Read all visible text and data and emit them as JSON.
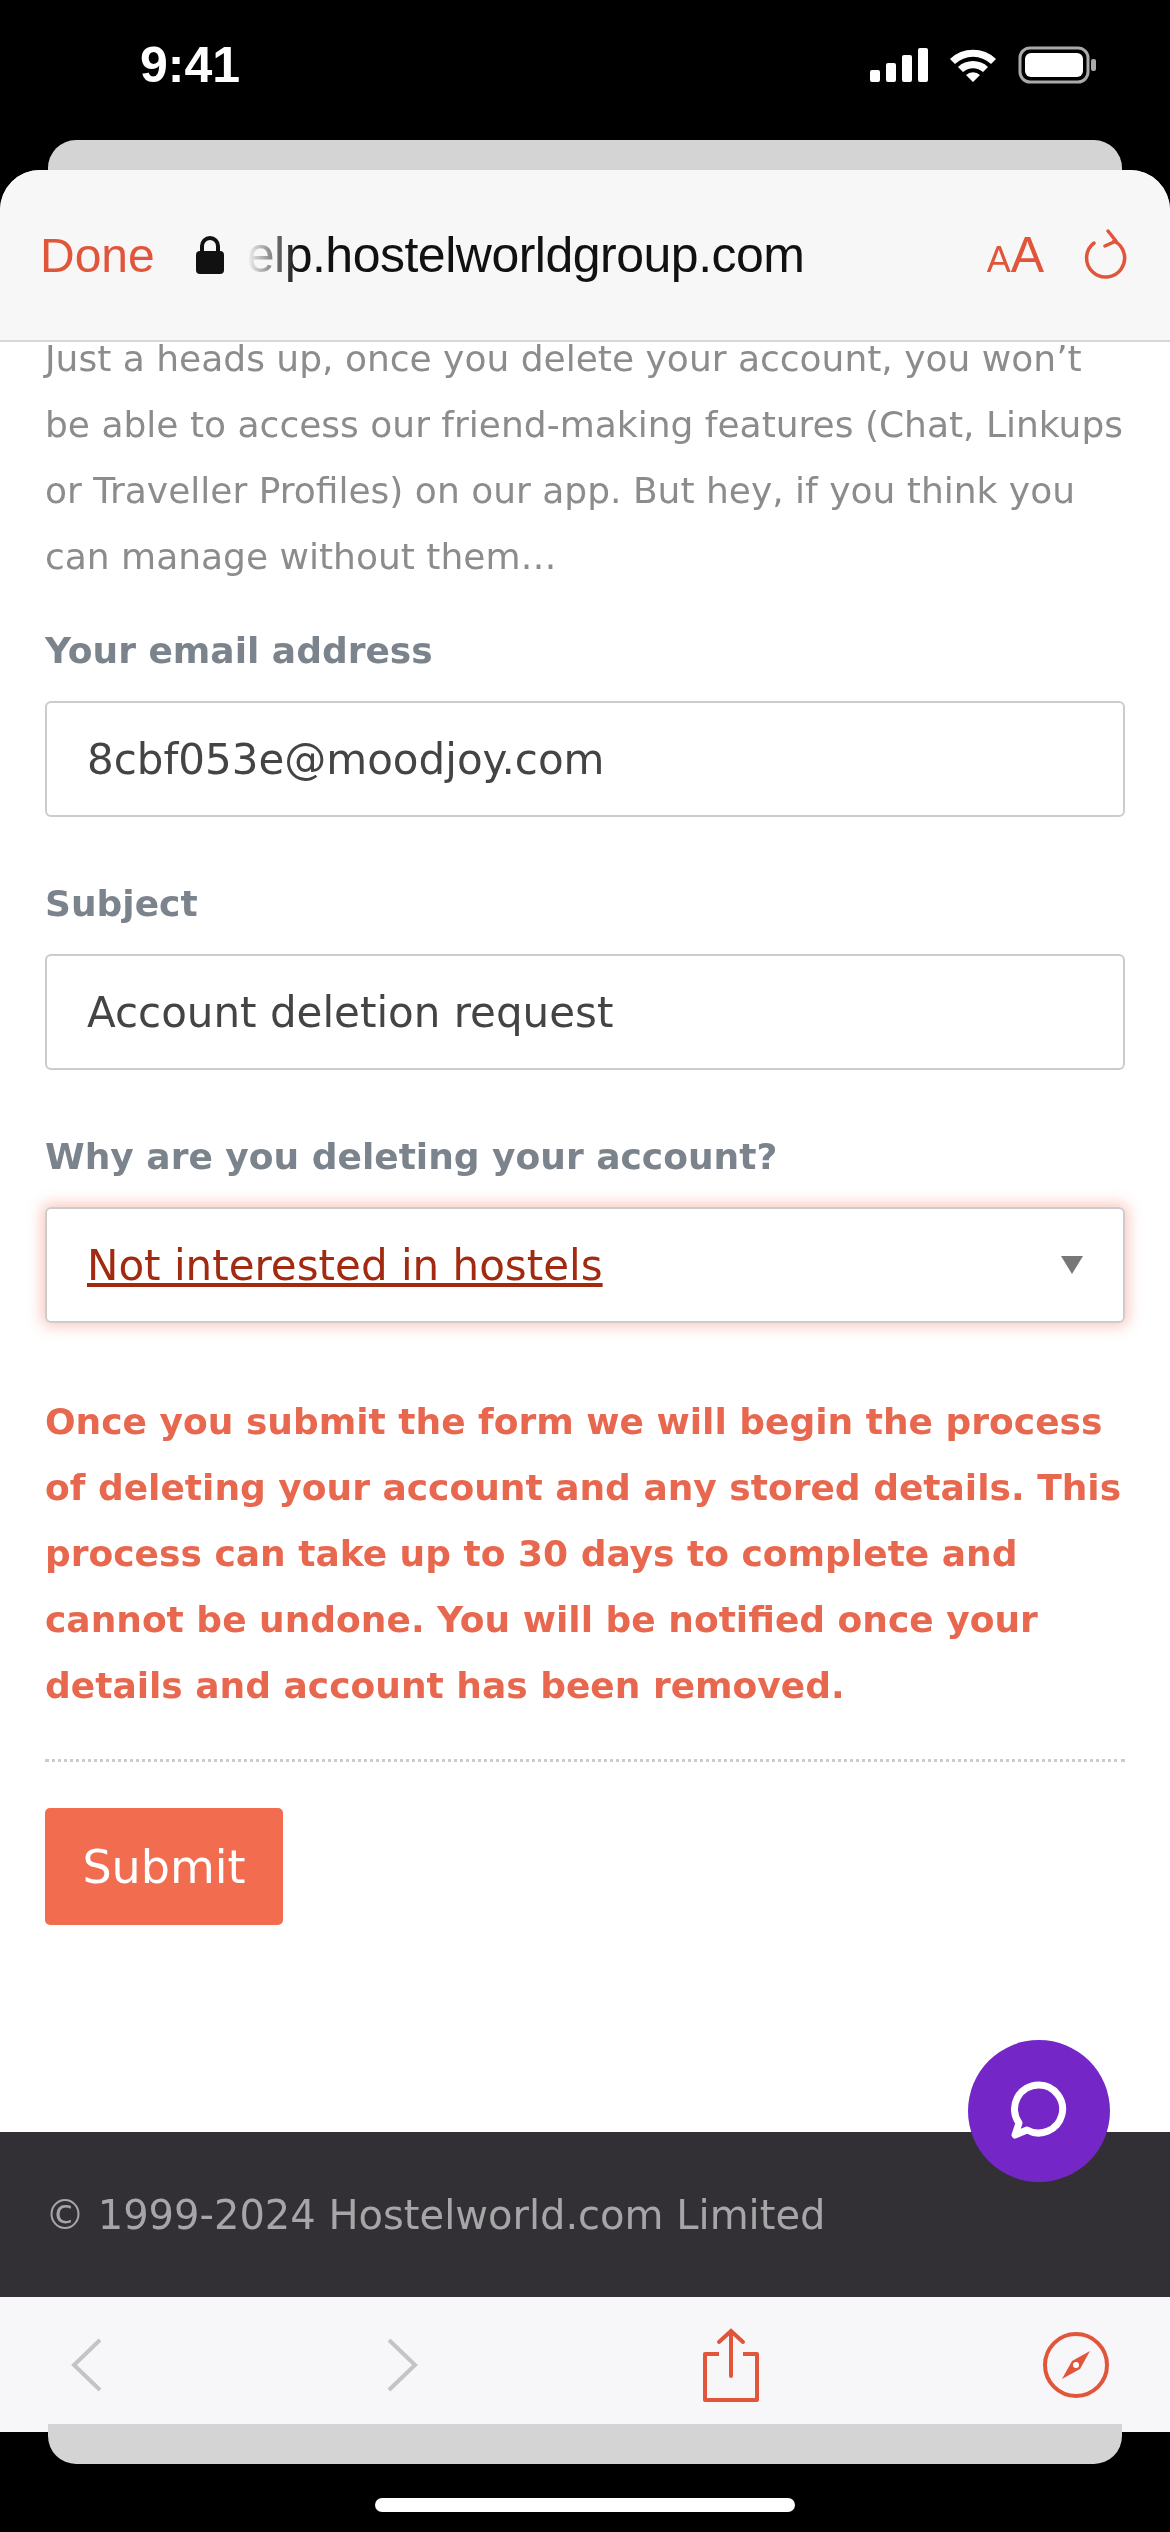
{
  "status_bar": {
    "time": "9:41"
  },
  "browser_toolbar": {
    "done": "Done",
    "url": "elp.hostelworldgroup.com",
    "text_size": {
      "small": "A",
      "large": "A"
    }
  },
  "page": {
    "intro": "Just a heads up, once you delete your account, you won’t be able to access our friend-making features (Chat, Linkups or Traveller Profiles) on our app. But hey, if you think you can manage without them…",
    "fields": [
      {
        "kind": "text",
        "label": "Your email address",
        "value": "8cbf053e@moodjoy.com",
        "focused": false
      },
      {
        "kind": "text",
        "label": "Subject",
        "value": "Account deletion request",
        "focused": false
      },
      {
        "kind": "select",
        "label": "Why are you deleting your account?",
        "value": "Not interested in hostels",
        "focused": true
      }
    ],
    "warning": "Once you submit the form we will begin the process of deleting your account and any stored details. This process can take up to 30 days to complete and cannot be undone. You will be notified once your details and account has been removed.",
    "submit": "Submit"
  },
  "footer": {
    "copyright": "© 1999-2024 Hostelworld.com Limited"
  },
  "bottom_toolbar": {
    "back_disabled": true,
    "forward_disabled": true
  }
}
